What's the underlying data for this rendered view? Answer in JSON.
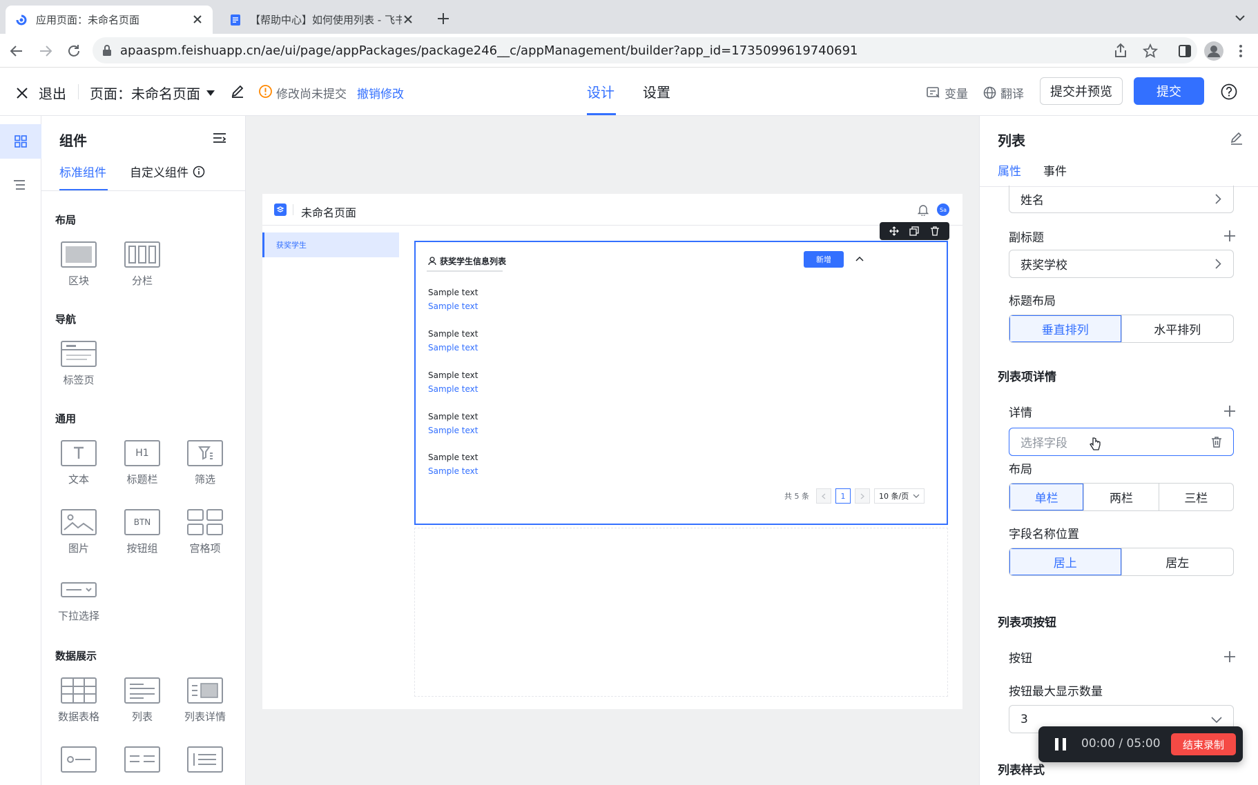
{
  "browser": {
    "tabs": [
      {
        "title": "应用页面：未命名页面"
      },
      {
        "title": "【帮助中心】如何使用列表 - 飞书"
      }
    ],
    "url": "apaaspm.feishuapp.cn/ae/ui/page/appPackages/package246__c/appManagement/builder?app_id=1735099619740691"
  },
  "header": {
    "exit_label": "退出",
    "page_label": "页面：未命名页面",
    "unsaved_text": "修改尚未提交",
    "undo_link": "撤销修改",
    "tabs": [
      {
        "label": "设计"
      },
      {
        "label": "设置"
      }
    ],
    "variable_label": "变量",
    "translate_label": "翻译",
    "submit_preview_label": "提交并预览",
    "submit_label": "提交"
  },
  "left_panel": {
    "title": "组件",
    "tabs": [
      {
        "label": "标准组件"
      },
      {
        "label": "自定义组件"
      }
    ],
    "sections": [
      {
        "title": "布局",
        "items": [
          "区块",
          "分栏"
        ]
      },
      {
        "title": "导航",
        "items": [
          "标签页"
        ]
      },
      {
        "title": "通用",
        "items": [
          "文本",
          "标题栏",
          "筛选",
          "图片",
          "按钮组",
          "宫格项",
          "下拉选择"
        ]
      },
      {
        "title": "数据展示",
        "items": [
          "数据表格",
          "列表",
          "列表详情"
        ]
      }
    ],
    "icon_text": {
      "h1": "H1",
      "btn": "BTN"
    }
  },
  "canvas": {
    "page_title": "未命名页面",
    "avatar_text": "Sa",
    "nav_item": "获奖学生",
    "list_title": "获奖学生信息列表",
    "add_button": "新增",
    "items": [
      {
        "title": "Sample text",
        "sub": "Sample text"
      },
      {
        "title": "Sample text",
        "sub": "Sample text"
      },
      {
        "title": "Sample text",
        "sub": "Sample text"
      },
      {
        "title": "Sample text",
        "sub": "Sample text"
      },
      {
        "title": "Sample text",
        "sub": "Sample text"
      }
    ],
    "pagination": {
      "total": "共 5 条",
      "current": "1",
      "page_size": "10 条/页"
    }
  },
  "right_panel": {
    "title": "列表",
    "tabs": [
      {
        "label": "属性"
      },
      {
        "label": "事件"
      }
    ],
    "title_field_value": "姓名",
    "subtitle_label": "副标题",
    "subtitle_value": "获奖学校",
    "title_layout_label": "标题布局",
    "title_layout_options": [
      "垂直排列",
      "水平排列"
    ],
    "detail_section": "列表项详情",
    "detail_label": "详情",
    "detail_placeholder": "选择字段",
    "layout_label": "布局",
    "layout_options": [
      "单栏",
      "两栏",
      "三栏"
    ],
    "field_position_label": "字段名称位置",
    "field_position_options": [
      "居上",
      "居左"
    ],
    "button_section": "列表项按钮",
    "button_label": "按钮",
    "max_buttons_label": "按钮最大显示数量",
    "max_buttons_value": "3",
    "style_section": "列表样式"
  },
  "recorder": {
    "time": "00:00 / 05:00",
    "stop_label": "结束录制"
  },
  "colors": {
    "accent": "#3370ff",
    "danger": "#f54a45",
    "warning": "#ff8800"
  }
}
